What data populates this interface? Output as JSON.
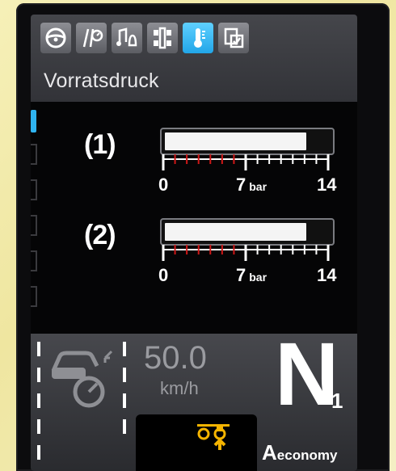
{
  "header": {
    "title": "Vorratsdruck",
    "tabs": [
      {
        "icon": "steering-wheel-icon",
        "active": false
      },
      {
        "icon": "road-speed-icon",
        "active": false
      },
      {
        "icon": "music-bell-icon",
        "active": false
      },
      {
        "icon": "axle-config-icon",
        "active": false
      },
      {
        "icon": "thermometer-icon",
        "active": true
      },
      {
        "icon": "checklist-icon",
        "active": false
      }
    ]
  },
  "gauges": [
    {
      "label": "(1)",
      "value": 12.0,
      "min": 0,
      "max": 14,
      "mid_label": "7",
      "unit": "bar",
      "min_label": "0",
      "max_label": "14"
    },
    {
      "label": "(2)",
      "value": 12.0,
      "min": 0,
      "max": 14,
      "mid_label": "7",
      "unit": "bar",
      "min_label": "0",
      "max_label": "14"
    }
  ],
  "status": {
    "speed": "50.0",
    "speed_unit": "km/h",
    "gear": "N",
    "gear_sub": "1",
    "mode_letter": "A",
    "mode_text": "economy",
    "warning_icon": "trailer-axle-lift-icon",
    "colors": {
      "active_tab": "#22a6e8",
      "warning": "#f5b400",
      "red_zone": "#d01818"
    }
  }
}
